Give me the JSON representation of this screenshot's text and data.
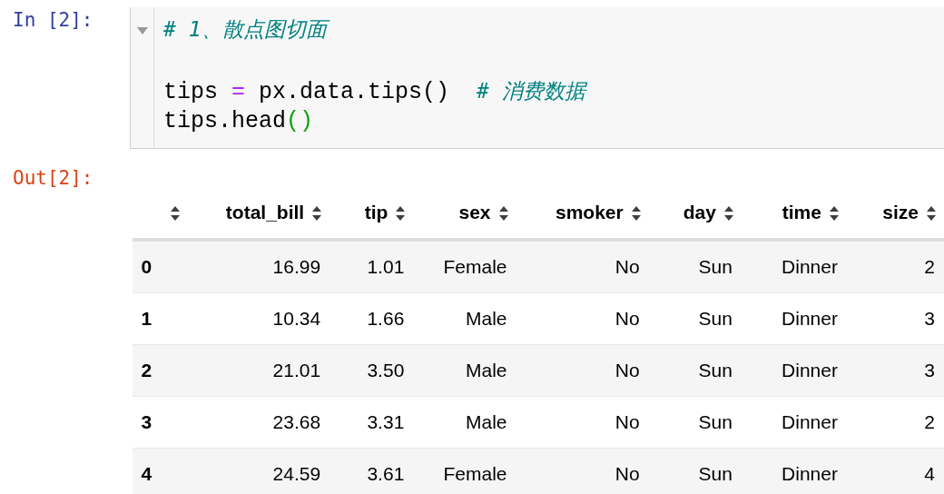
{
  "input_cell": {
    "prompt": "In [2]:",
    "lines": [
      {
        "kind": "code",
        "tokens": [
          {
            "kind": "comment",
            "text": "# 1、散点图切面"
          }
        ]
      },
      {
        "kind": "blank"
      },
      {
        "kind": "code",
        "tokens": [
          {
            "kind": "plain",
            "text": "tips "
          },
          {
            "kind": "operator",
            "text": "="
          },
          {
            "kind": "plain",
            "text": " px.data.tips()  "
          },
          {
            "kind": "comment",
            "text": "# 消费数据"
          }
        ]
      },
      {
        "kind": "code",
        "tokens": [
          {
            "kind": "plain",
            "text": "tips.head"
          },
          {
            "kind": "paren",
            "text": "()"
          }
        ]
      }
    ]
  },
  "output_cell": {
    "prompt": "Out[2]:",
    "table": {
      "columns": [
        "",
        "total_bill",
        "tip",
        "sex",
        "smoker",
        "day",
        "time",
        "size"
      ],
      "rows": [
        [
          "0",
          "16.99",
          "1.01",
          "Female",
          "No",
          "Sun",
          "Dinner",
          "2"
        ],
        [
          "1",
          "10.34",
          "1.66",
          "Male",
          "No",
          "Sun",
          "Dinner",
          "3"
        ],
        [
          "2",
          "21.01",
          "3.50",
          "Male",
          "No",
          "Sun",
          "Dinner",
          "3"
        ],
        [
          "3",
          "23.68",
          "3.31",
          "Male",
          "No",
          "Sun",
          "Dinner",
          "2"
        ],
        [
          "4",
          "24.59",
          "3.61",
          "Female",
          "No",
          "Sun",
          "Dinner",
          "4"
        ]
      ]
    }
  }
}
